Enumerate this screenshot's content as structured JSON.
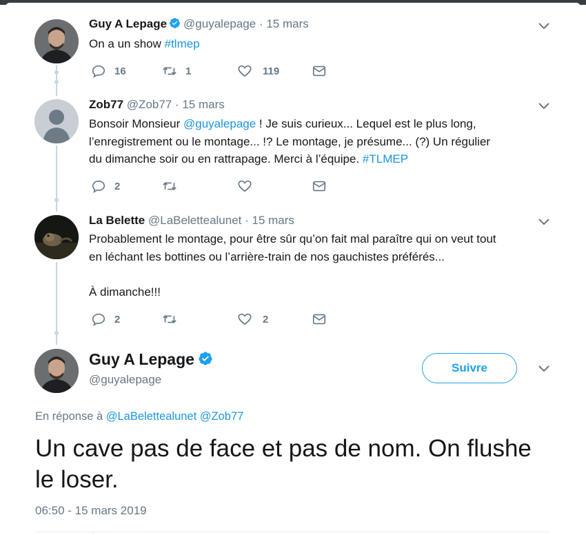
{
  "colors": {
    "accent": "#1da1f2",
    "link": "#1b95e0",
    "muted": "#657786",
    "thread": "#c5d6e3"
  },
  "tweets": [
    {
      "name": "Guy A Lepage",
      "verified": true,
      "handle": "@guyalepage",
      "sep": " · ",
      "date": "15 mars",
      "text_plain": "On a un show ",
      "hashtag": "#tlmep",
      "replies": "16",
      "retweets": "1",
      "likes": "119"
    },
    {
      "name": "Zob77",
      "handle": "@Zob77",
      "sep": " · ",
      "date": "15 mars",
      "text_a": "Bonsoir Monsieur ",
      "mention": "@guyalepage",
      "text_b": " !   Je suis curieux...  Lequel est le plus long,\nl’enregistrement ou le montage... !?  Le montage, je présume... (?)  Un régulier\ndu dimanche soir ou en rattrapage.  Merci à l’équipe.  ",
      "hashtag": "#TLMEP",
      "replies": "2",
      "retweets": "",
      "likes": ""
    },
    {
      "name": "La Belette",
      "handle": "@LaBelettealunet",
      "sep": " · ",
      "date": "15 mars",
      "text": "Probablement le montage, pour être sûr qu’on fait mal paraître qui on veut tout\nen léchant les bottines ou l’arrière-train de nos gauchistes préférés...\n\nÀ dimanche!!!",
      "replies": "2",
      "retweets": "",
      "likes": "2"
    }
  ],
  "main_tweet": {
    "name": "Guy A Lepage",
    "verified": true,
    "handle": "@guyalepage",
    "follow_label": "Suivre",
    "reply_prefix": "En réponse à ",
    "reply_mentions": "@LaBelettealunet @Zob77",
    "text": "Un cave pas de face et pas de nom. On flushe le loser.",
    "timestamp": "06:50 - 15 mars 2019"
  },
  "icons": [
    "reply-icon",
    "retweet-icon",
    "like-icon",
    "message-icon",
    "chevron-down-icon",
    "verified-icon"
  ]
}
